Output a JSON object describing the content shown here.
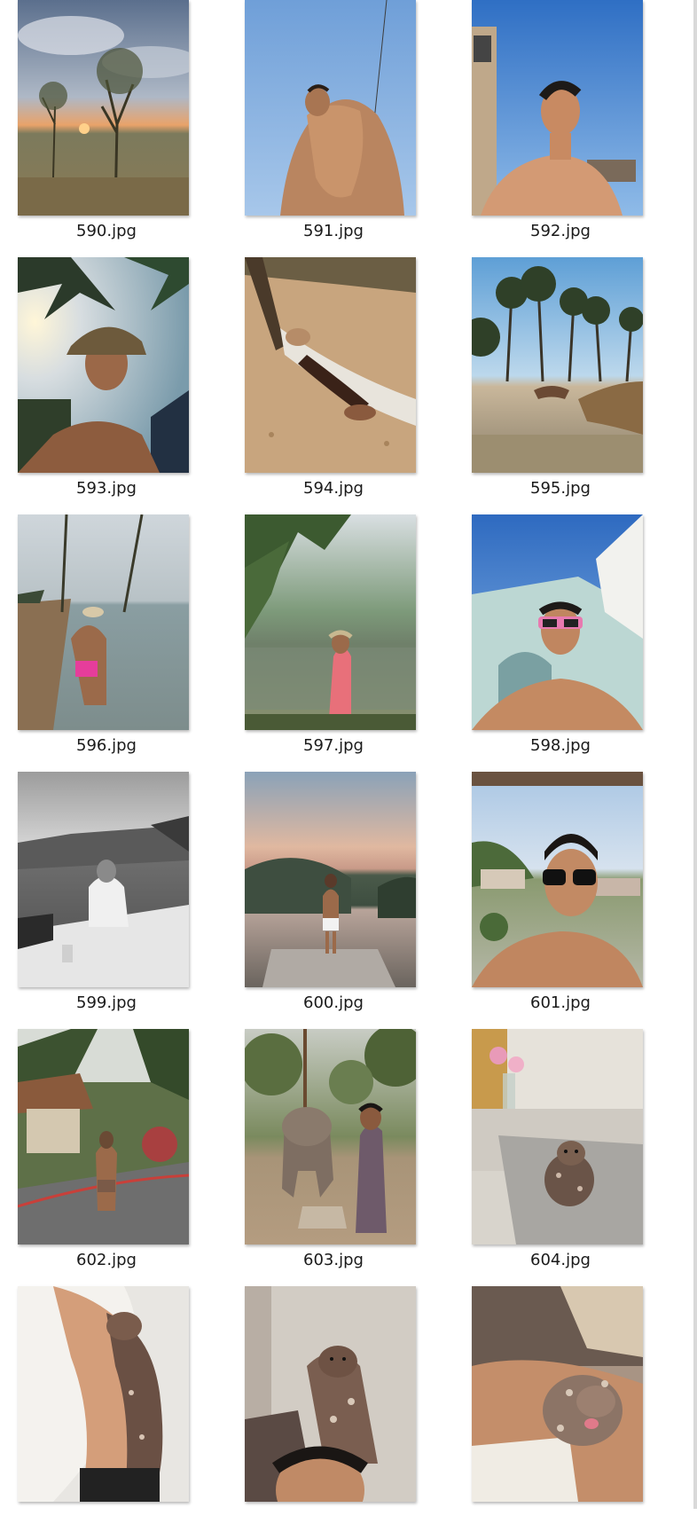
{
  "files": [
    {
      "name": "590.jpg",
      "scene": "sunset-field-photo"
    },
    {
      "name": "591.jpg",
      "scene": "shirtless-sky-photo"
    },
    {
      "name": "592.jpg",
      "scene": "rooftop-sun-photo"
    },
    {
      "name": "593.jpg",
      "scene": "hat-palm-selfie-photo"
    },
    {
      "name": "594.jpg",
      "scene": "hammock-sand-photo"
    },
    {
      "name": "595.jpg",
      "scene": "beach-swing-photo"
    },
    {
      "name": "596.jpg",
      "scene": "beach-shore-photo"
    },
    {
      "name": "597.jpg",
      "scene": "river-palm-photo"
    },
    {
      "name": "598.jpg",
      "scene": "building-sunglasses-photo"
    },
    {
      "name": "599.jpg",
      "scene": "mono-pool-photo"
    },
    {
      "name": "600.jpg",
      "scene": "infinity-pool-dusk-photo"
    },
    {
      "name": "601.jpg",
      "scene": "sunglasses-selfie-photo"
    },
    {
      "name": "602.jpg",
      "scene": "resort-garden-photo"
    },
    {
      "name": "603.jpg",
      "scene": "elephant-forest-photo"
    },
    {
      "name": "604.jpg",
      "scene": "sofa-dog-photo"
    },
    {
      "name": "",
      "scene": "bed-dog-photo"
    },
    {
      "name": "",
      "scene": "dog-selfie-photo"
    },
    {
      "name": "",
      "scene": "lap-dog-photo"
    }
  ]
}
